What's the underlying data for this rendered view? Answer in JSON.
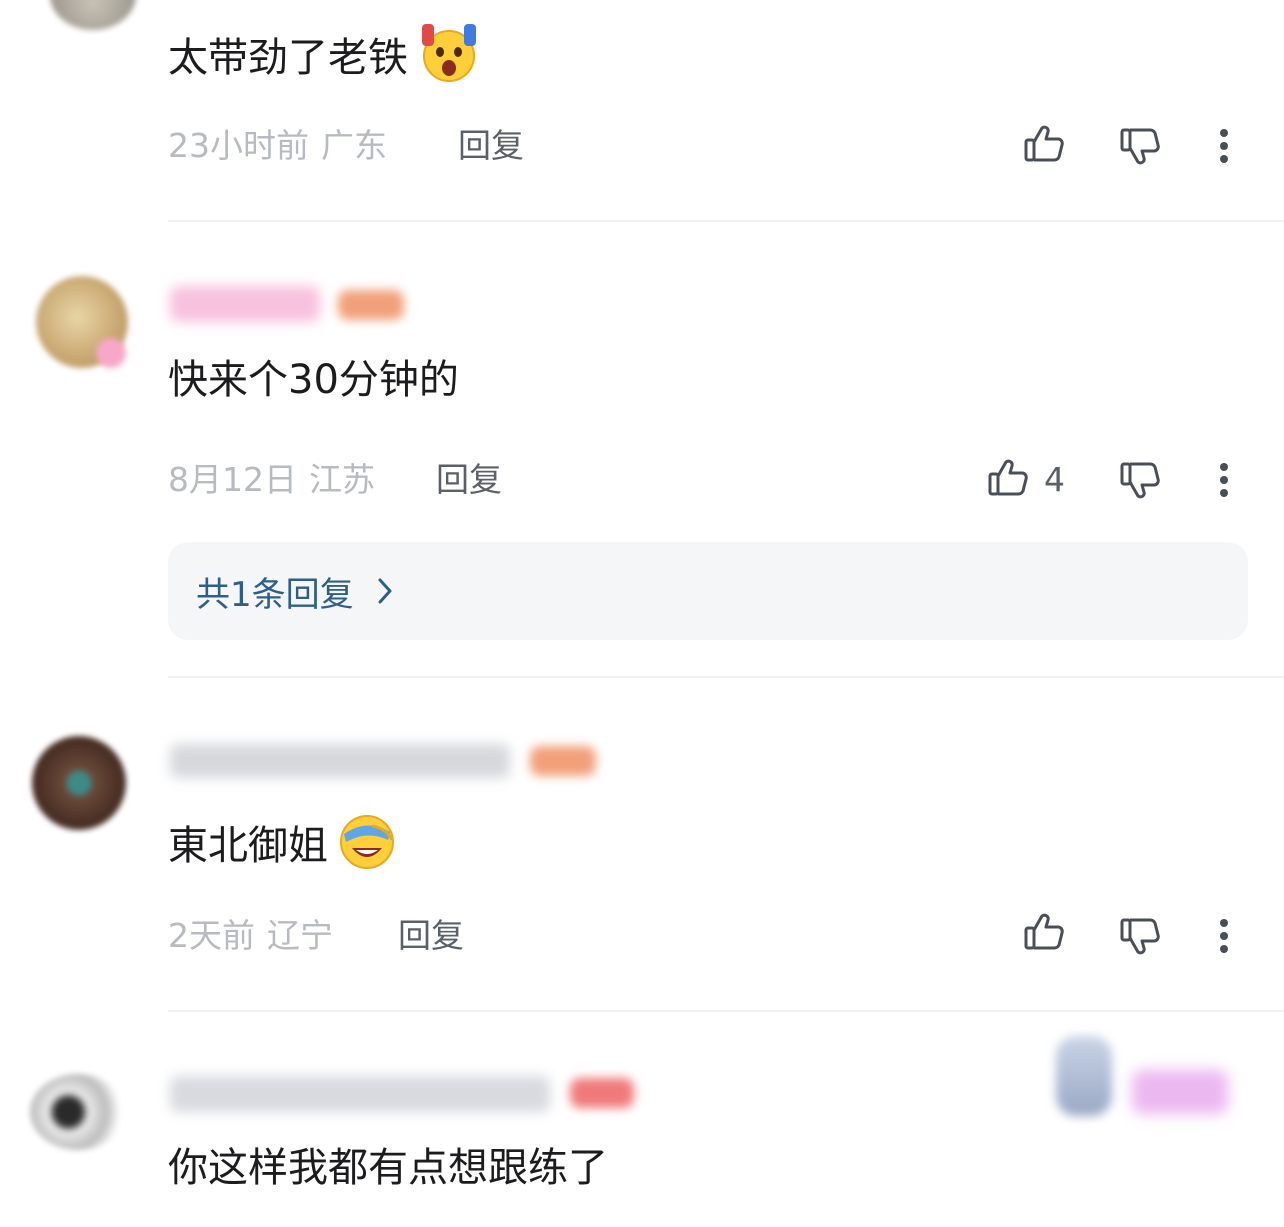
{
  "comments": [
    {
      "text": "太带劲了老铁",
      "emoji": "scream-emoji",
      "time": "23小时前",
      "location": "广东",
      "reply_label": "回复",
      "like_count": ""
    },
    {
      "text": "快来个30分钟的",
      "emoji": "",
      "time": "8月12日",
      "location": "江苏",
      "reply_label": "回复",
      "like_count": "4",
      "replies_label": "共1条回复"
    },
    {
      "text": "東北御姐",
      "emoji": "laugh-cry-emoji",
      "time": "2天前",
      "location": "辽宁",
      "reply_label": "回复",
      "like_count": ""
    },
    {
      "text": "你这样我都有点想跟练了",
      "emoji": ""
    }
  ],
  "icons": {
    "like": "thumbs-up-icon",
    "dislike": "thumbs-down-icon",
    "more": "more-vertical-icon",
    "chevron": "chevron-right-icon"
  },
  "colors": {
    "meta_text": "#b7bac0",
    "reply_text": "#5a5f68",
    "link_blue": "#2e5f8a",
    "reply_box_bg": "#f4f6f8",
    "badge_orange": "#f2a07a"
  }
}
